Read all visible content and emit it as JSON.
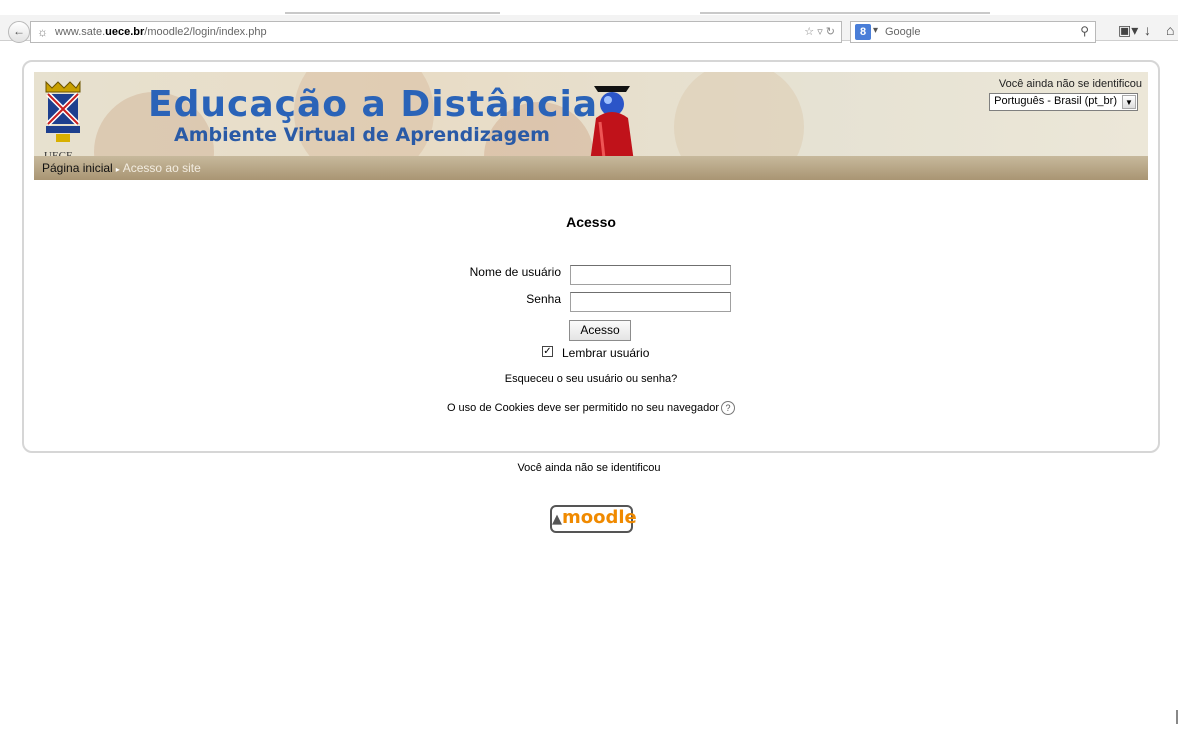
{
  "browser": {
    "url_prefix": "www.sate.",
    "url_domain": "uece.br",
    "url_path": "/moodle2/login/index.php",
    "search_placeholder": "Google",
    "search_engine_letter": "8"
  },
  "header": {
    "title": "Educação a Distância",
    "subtitle": "Ambiente Virtual de Aprendizagem",
    "crest_label": "UECE",
    "login_status": "Você ainda não se identificou",
    "language": "Português - Brasil (pt_br)"
  },
  "breadcrumb": {
    "home": "Página inicial",
    "separator": "▸",
    "current": "Acesso ao site"
  },
  "login": {
    "heading": "Acesso",
    "username_label": "Nome de usuário",
    "username_value": "",
    "password_label": "Senha",
    "password_value": "",
    "submit_label": "Acesso",
    "remember_label": "Lembrar usuário",
    "remember_checked": true,
    "forgot_link": "Esqueceu o seu usuário ou senha?",
    "cookie_notice": "O uso de Cookies deve ser permitido no seu navegador"
  },
  "footer": {
    "login_status": "Você ainda não se identificou",
    "logo_text": "moodle"
  }
}
